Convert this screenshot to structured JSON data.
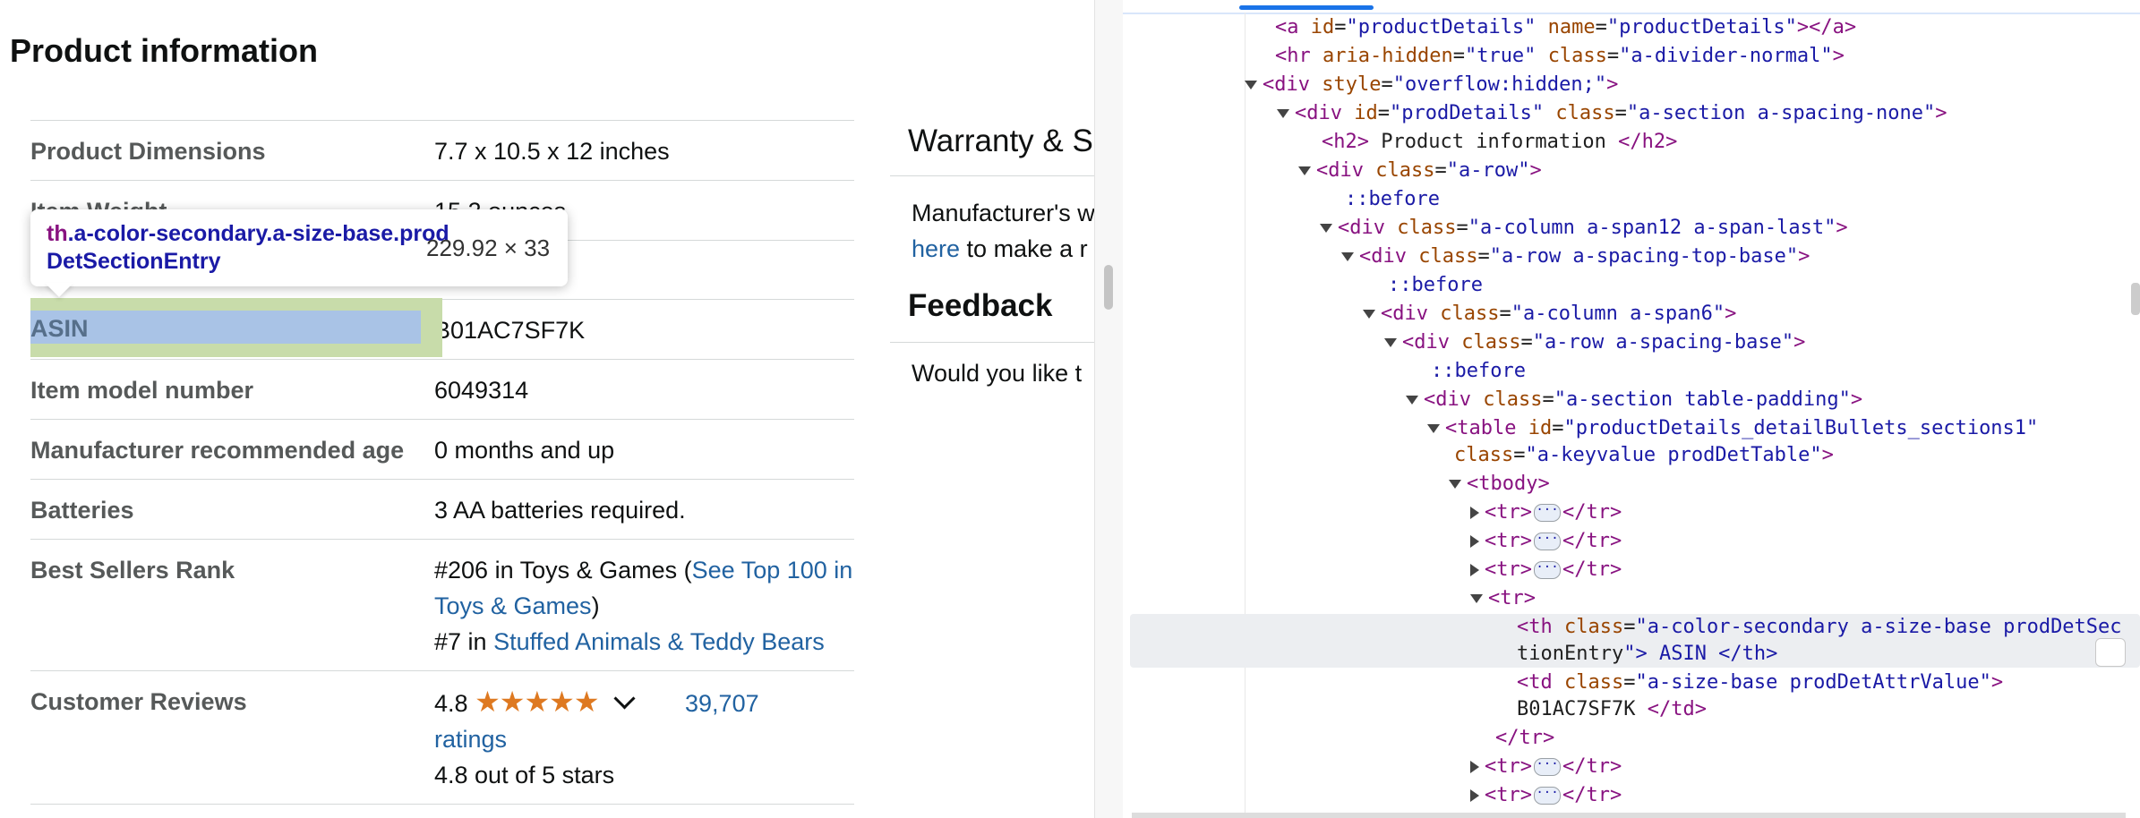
{
  "page": {
    "title": "Product information",
    "table": [
      {
        "label": "Product Dimensions",
        "value": "7.7 x 10.5 x 12 inches"
      },
      {
        "label": "Item Weight",
        "value": "15.2 ounces"
      },
      {
        "label": "",
        "value": ""
      },
      {
        "label": "ASIN",
        "value": "B01AC7SF7K"
      },
      {
        "label": "Item model number",
        "value": "6049314"
      },
      {
        "label": "Manufacturer recommended age",
        "value": "0 months and up"
      },
      {
        "label": "Batteries",
        "value": "3 AA batteries required."
      }
    ],
    "best_sellers": {
      "label": "Best Sellers Rank",
      "rank1": "#206 in Toys & Games (",
      "rank1_link": "See Top 100 in Toys & Games",
      "rank1_close": ")",
      "rank2": "#7 in ",
      "rank2_link": "Stuffed Animals & Teddy Bears"
    },
    "reviews": {
      "label": "Customer Reviews",
      "rating": "4.8",
      "stars": "★★★★★",
      "count_link": "39,707",
      "ratings_word": "ratings",
      "summary": "4.8 out of 5 stars"
    },
    "warranty_heading": "Warranty & S",
    "manufacturer_line1": "Manufacturer's w",
    "manufacturer_link": "here",
    "manufacturer_line2": " to make a r",
    "feedback_heading": "Feedback",
    "feedback_text": "Would you like t"
  },
  "tooltip": {
    "tag": "th",
    "selector": ".a-color-secondary.a-size-base.prodDetSectionEntry",
    "dimensions": "229.92 × 33"
  },
  "highlight_label": "ASIN",
  "devtools": {
    "lines": [
      {
        "text": "<a id=\"productDetails\" name=\"productDetails\"></a>"
      },
      {
        "text": "<hr aria-hidden=\"true\" class=\"a-divider-normal\">"
      },
      {
        "text": "<div style=\"overflow:hidden;\">"
      },
      {
        "text": "<div id=\"prodDetails\" class=\"a-section a-spacing-none\">"
      },
      {
        "text": "<h2> Product information </h2>"
      },
      {
        "text": "<div class=\"a-row\">"
      },
      {
        "text": "::before"
      },
      {
        "text": "<div class=\"a-column a-span12 a-span-last\">"
      },
      {
        "text": "<div class=\"a-row a-spacing-top-base\">"
      },
      {
        "text": "::before"
      },
      {
        "text": "<div class=\"a-column a-span6\">"
      },
      {
        "text": "<div class=\"a-row a-spacing-base\">"
      },
      {
        "text": "::before"
      },
      {
        "text": "<div class=\"a-section table-padding\">"
      },
      {
        "text": "<table id=\"productDetails_detailBullets_sections1\""
      },
      {
        "text": "class=\"a-keyvalue prodDetTable\">"
      },
      {
        "text": "<tbody>"
      },
      {
        "text": "<tr>"
      },
      {
        "text": "<tr>"
      },
      {
        "text": "<tr>"
      },
      {
        "text": "<tr>"
      },
      {
        "text": "<th class=\"a-color-secondary a-size-base prodDetSec"
      },
      {
        "text": "tionEntry\"> ASIN </th>"
      },
      {
        "text": "<td class=\"a-size-base prodDetAttrValue\">"
      },
      {
        "text": "B01AC7SF7K </td>"
      },
      {
        "text": "</tr>"
      },
      {
        "text": "<tr>"
      },
      {
        "text": "<tr>"
      }
    ]
  }
}
